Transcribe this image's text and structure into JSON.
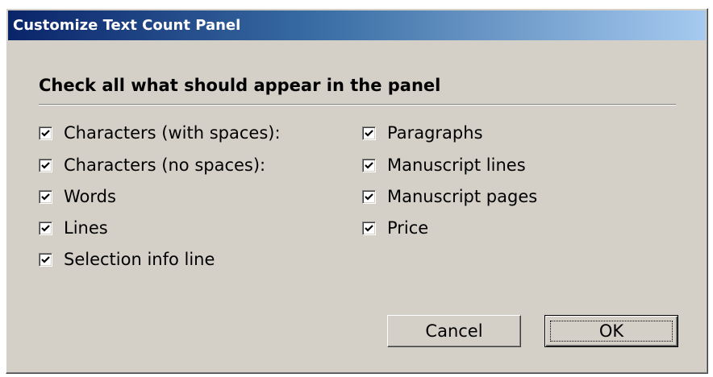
{
  "window": {
    "title": "Customize Text Count Panel"
  },
  "content": {
    "heading": "Check all what should appear in the panel"
  },
  "options": {
    "left": [
      {
        "label": "Characters (with spaces):",
        "checked": true
      },
      {
        "label": "Characters (no spaces):",
        "checked": true
      },
      {
        "label": "Words",
        "checked": true
      },
      {
        "label": "Lines",
        "checked": true
      },
      {
        "label": "Selection info line",
        "checked": true
      }
    ],
    "right": [
      {
        "label": "Paragraphs",
        "checked": true
      },
      {
        "label": "Manuscript lines",
        "checked": true
      },
      {
        "label": "Manuscript pages",
        "checked": true
      },
      {
        "label": "Price",
        "checked": true
      }
    ]
  },
  "buttons": {
    "cancel_label": "Cancel",
    "ok_label": "OK"
  },
  "colors": {
    "dialog_face": "#d4d0c8",
    "titlebar_start": "#0a246a",
    "titlebar_end": "#a6caf0",
    "title_text": "#ffffff"
  },
  "icons": {
    "checkbox_mark": "checkmark-icon"
  }
}
